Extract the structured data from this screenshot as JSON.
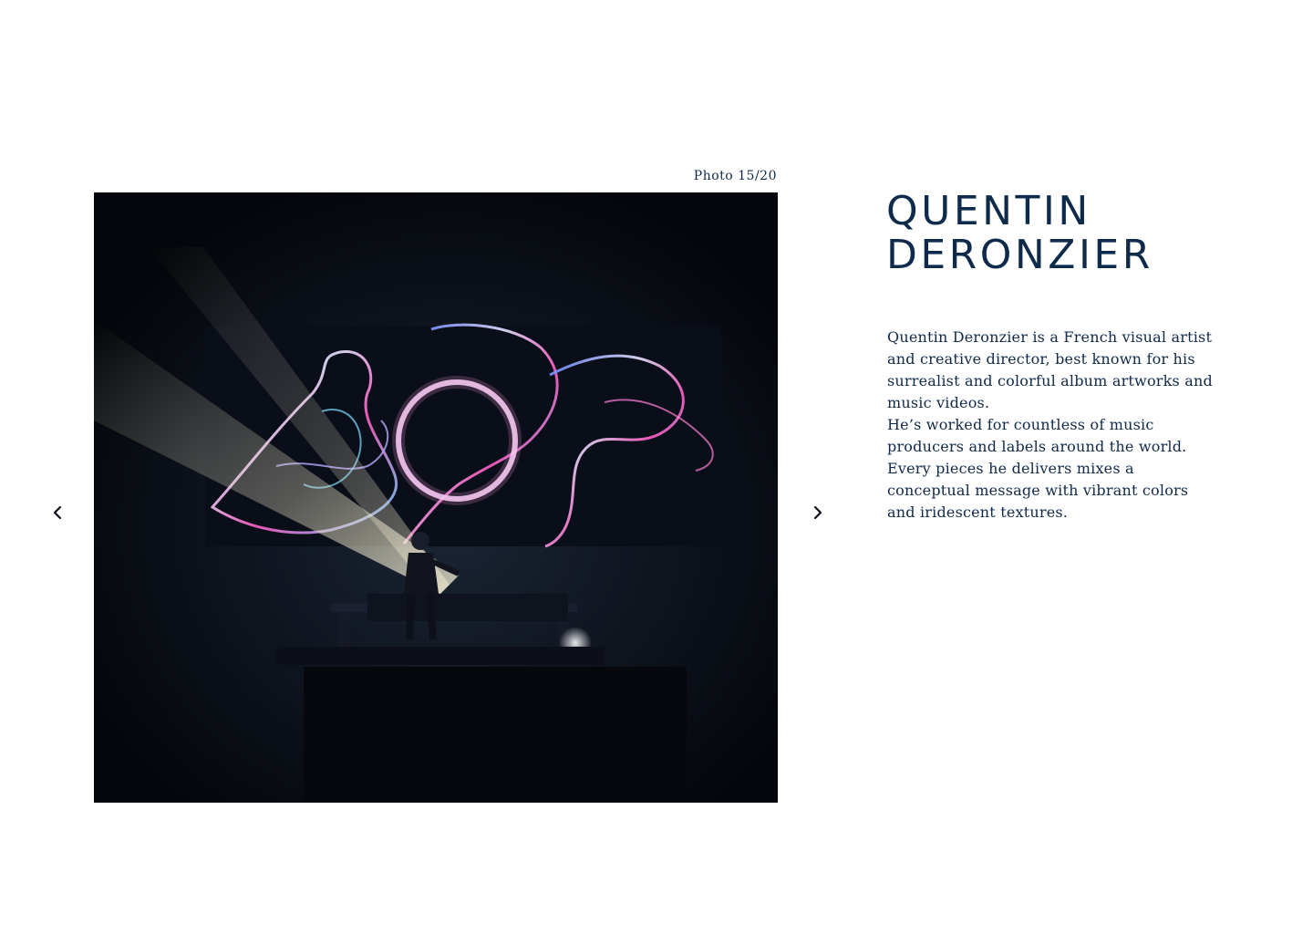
{
  "gallery": {
    "counter": "Photo 15/20",
    "photo_alt": "Live performance with iridescent statue visuals on screen",
    "prev_icon": "chevron-left-icon",
    "next_icon": "chevron-right-icon"
  },
  "artist": {
    "name_line1": "QUENTIN",
    "name_line2": "DERONZIER",
    "bio_paragraphs": [
      "Quentin Deronzier is a French visual artist and creative director, best known for his surrealist and colorful album artworks and music videos.",
      "He’s worked for countless of music producers and labels around the world. Every pieces he delivers mixes a conceptual message with vibrant colors and iridescent textures."
    ]
  },
  "colors": {
    "text": "#10294a",
    "background": "#ffffff",
    "photo_background": "#05070d"
  }
}
